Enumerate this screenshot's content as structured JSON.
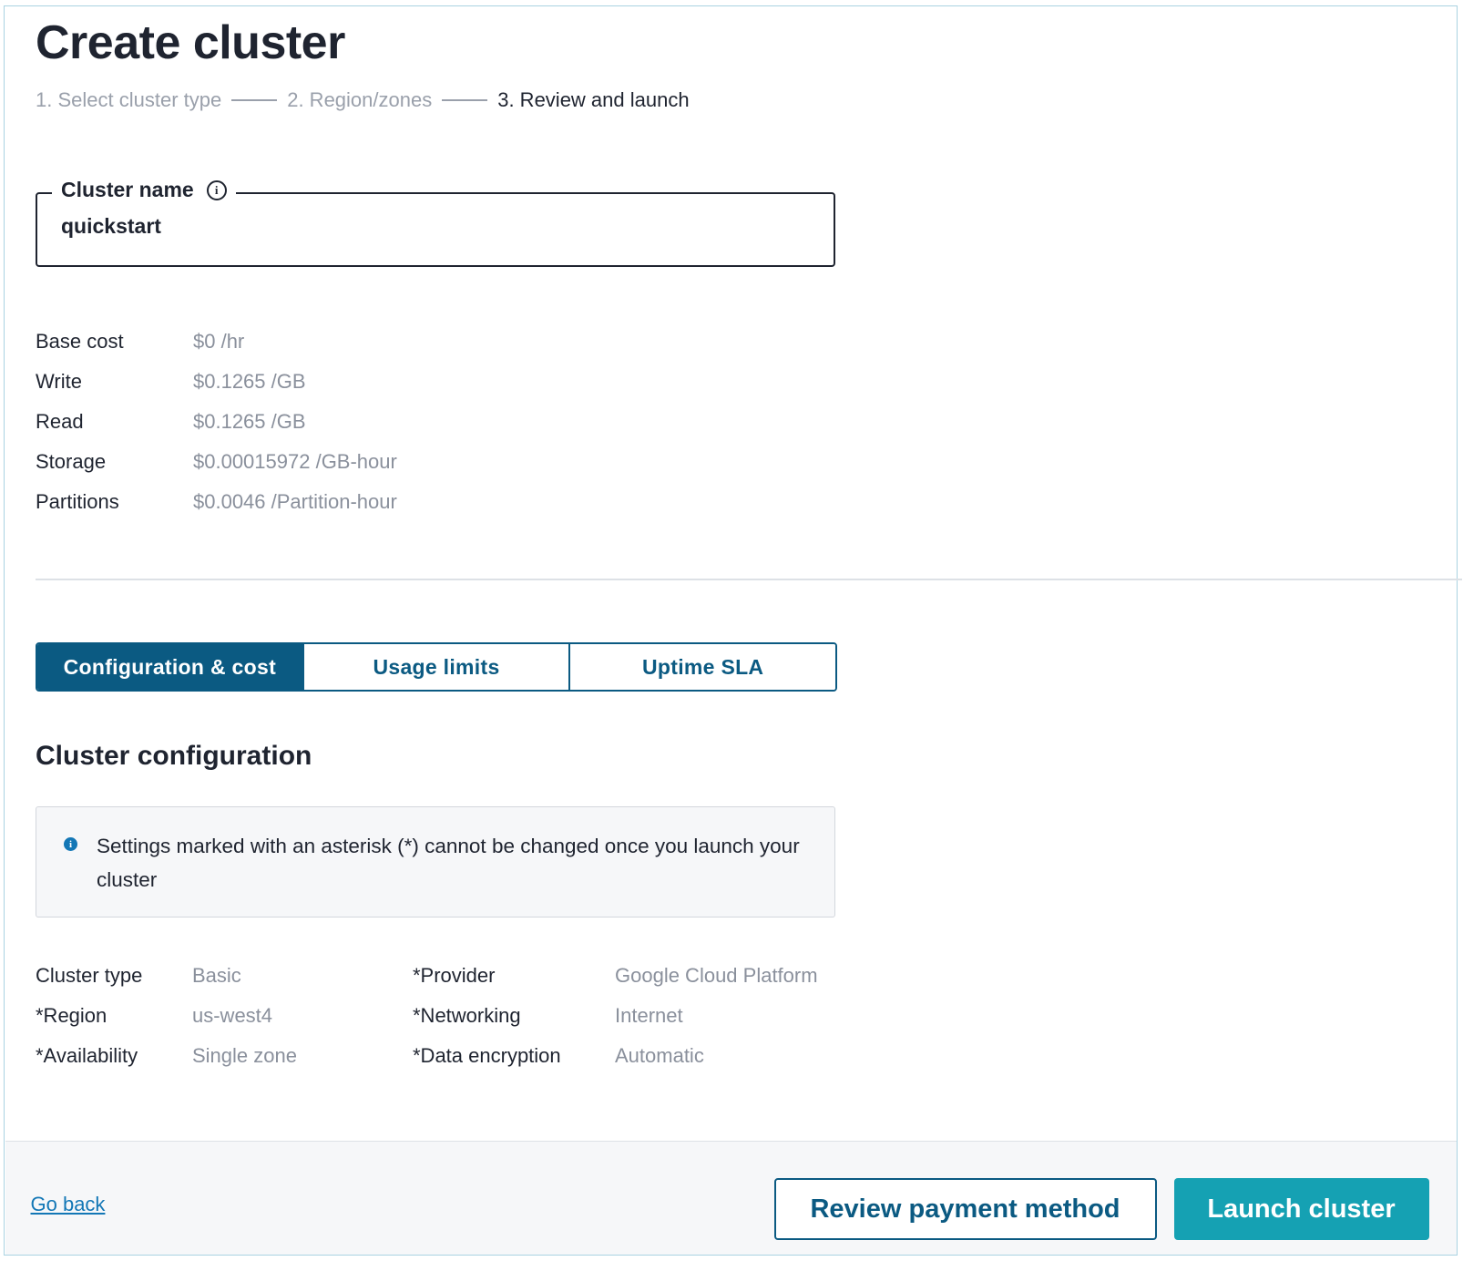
{
  "page": {
    "title": "Create cluster"
  },
  "stepper": {
    "steps": [
      {
        "label": "1. Select cluster type",
        "state": "done"
      },
      {
        "label": "2. Region/zones",
        "state": "done"
      },
      {
        "label": "3. Review and launch",
        "state": "active"
      }
    ]
  },
  "cluster_name": {
    "label": "Cluster name",
    "value": "quickstart",
    "icon": "info-icon"
  },
  "costs": [
    {
      "label": "Base cost",
      "value": "$0 /hr"
    },
    {
      "label": "Write",
      "value": "$0.1265 /GB"
    },
    {
      "label": "Read",
      "value": "$0.1265 /GB"
    },
    {
      "label": "Storage",
      "value": "$0.00015972 /GB-hour"
    },
    {
      "label": "Partitions",
      "value": "$0.0046 /Partition-hour"
    }
  ],
  "tabs": [
    {
      "label": "Configuration & cost",
      "selected": true
    },
    {
      "label": "Usage limits",
      "selected": false
    },
    {
      "label": "Uptime SLA",
      "selected": false
    }
  ],
  "section": {
    "title": "Cluster configuration"
  },
  "notice": {
    "icon": "info-icon",
    "text": "Settings marked with an asterisk (*) cannot be changed once you launch your cluster"
  },
  "config": {
    "left": [
      {
        "label": "Cluster type",
        "value": "Basic"
      },
      {
        "label": "*Region",
        "value": "us-west4"
      },
      {
        "label": "*Availability",
        "value": "Single zone"
      }
    ],
    "right": [
      {
        "label": "*Provider",
        "value": "Google Cloud Platform"
      },
      {
        "label": "*Networking",
        "value": "Internet"
      },
      {
        "label": "*Data encryption",
        "value": "Automatic"
      }
    ]
  },
  "footer": {
    "go_back": "Go back",
    "review_payment": "Review payment method",
    "launch": "Launch cluster"
  },
  "colors": {
    "brand_dark": "#0b5a82",
    "brand_teal": "#15a1b3",
    "link": "#1377b6",
    "muted_text": "#8a909c"
  }
}
